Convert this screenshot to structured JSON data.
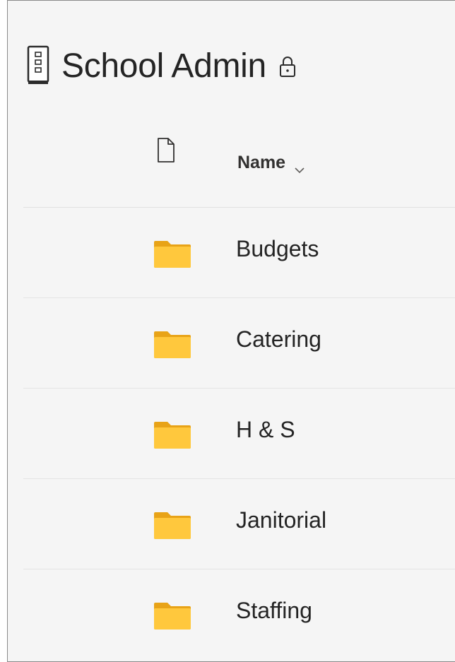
{
  "library": {
    "title": "School Admin",
    "icon": "document-library-icon",
    "lock_icon": "lock-icon"
  },
  "columns": {
    "type_icon": "file-icon",
    "name_label": "Name",
    "sort_icon": "chevron-down-icon"
  },
  "items": [
    {
      "label": "Budgets",
      "icon": "folder-icon"
    },
    {
      "label": "Catering",
      "icon": "folder-icon"
    },
    {
      "label": "H & S",
      "icon": "folder-icon"
    },
    {
      "label": "Janitorial",
      "icon": "folder-icon"
    },
    {
      "label": "Staffing",
      "icon": "folder-icon"
    }
  ],
  "colors": {
    "background": "#f5f5f5",
    "text": "#242424",
    "folder": "#ffc83d",
    "divider": "#e1e1e1"
  }
}
